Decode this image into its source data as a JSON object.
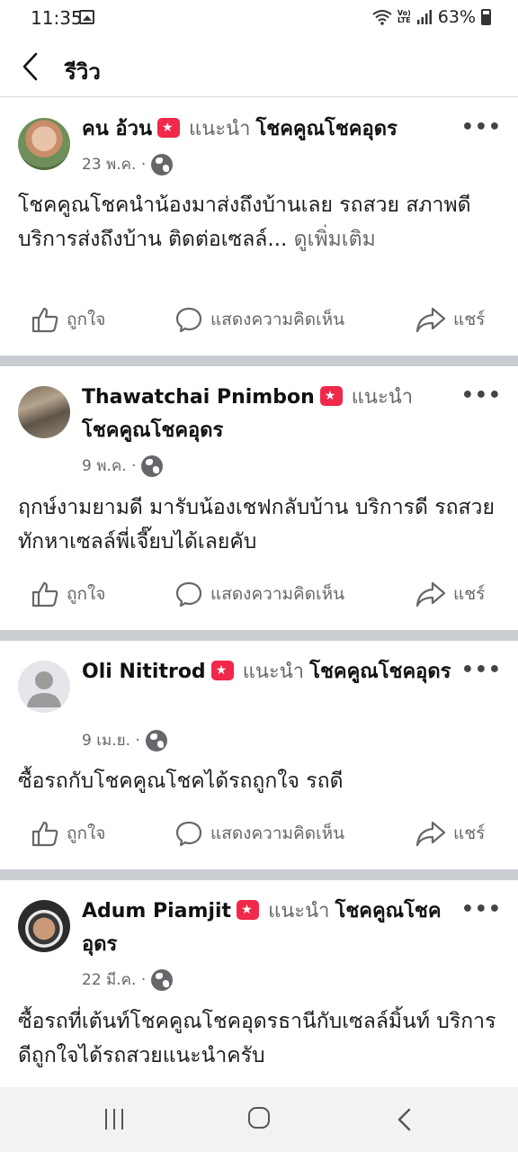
{
  "status_bar": {
    "time": "11:35",
    "battery": "63%"
  },
  "header": {
    "title": "รีวิว"
  },
  "recommend_word": "แนะนำ",
  "actions": {
    "like": "ถูกใจ",
    "comment": "แสดงความคิดเห็น",
    "share": "แชร์"
  },
  "reviews": [
    {
      "author": "คน อ้วน",
      "page": "โชคคูณโชคอุดร",
      "date": "23 พ.ค. ·",
      "text": "โชคคูณโชคนำน้องมาส่งถึงบ้านเลย  รถสวย สภาพดี บริการส่งถึงบ้าน  ติดต่อเซลล์...",
      "see_more": "ดูเพิ่มเติม"
    },
    {
      "author": "Thawatchai Pnimbon",
      "page": "โชคคูณโชคอุดร",
      "date": "9 พ.ค. ·",
      "text": "ฤกษ์งามยามดี  มารับน้องเชฟกลับบ้าน  บริการดี  รถสวย  ทักหาเซลล์พี่เจี๊ยบได้เลยคับ"
    },
    {
      "author": "Oli Nititrod",
      "page": "โชคคูณโชคอุดร",
      "date": "9 เม.ย. ·",
      "text": "ซื้อรถกับโชคคูณโชคได้รถถูกใจ รถดี"
    },
    {
      "author": "Adum Piamjit",
      "page": "โชคคูณโชคอุดร",
      "date": "22 มี.ค. ·",
      "text": "ซื้อรถที่เต้นท์โชคคูณโชคอุดรธานีกับเซลล์มิ้นท์ บริการดีถูกใจได้รถสวยแนะนำครับ"
    }
  ]
}
